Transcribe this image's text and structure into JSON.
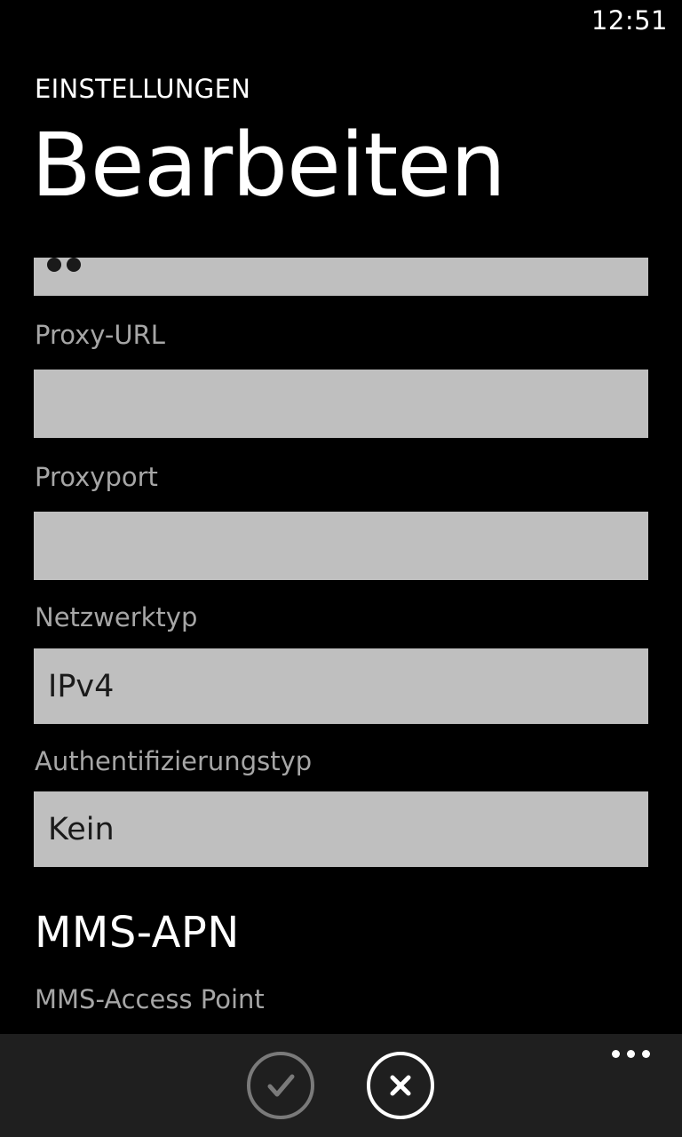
{
  "status_bar": {
    "time": "12:51"
  },
  "header": {
    "app_title": "EINSTELLUNGEN",
    "page_title": "Bearbeiten"
  },
  "form": {
    "password_field": {
      "masked_value": "●●"
    },
    "proxy_url": {
      "label": "Proxy-URL",
      "value": ""
    },
    "proxy_port": {
      "label": "Proxyport",
      "value": ""
    },
    "network_type": {
      "label": "Netzwerktyp",
      "value": "IPv4"
    },
    "auth_type": {
      "label": "Authentifizierungstyp",
      "value": "Kein"
    },
    "mms_section": {
      "title": "MMS-APN",
      "access_point_label": "MMS-Access Point"
    }
  },
  "app_bar": {
    "confirm_icon": "check-icon",
    "cancel_icon": "close-icon",
    "more_icon": "ellipsis-icon"
  },
  "colors": {
    "background": "#000000",
    "field_background": "#bfbfbf",
    "label_color": "#a6a6a6",
    "app_bar_background": "#1f1f1f"
  }
}
